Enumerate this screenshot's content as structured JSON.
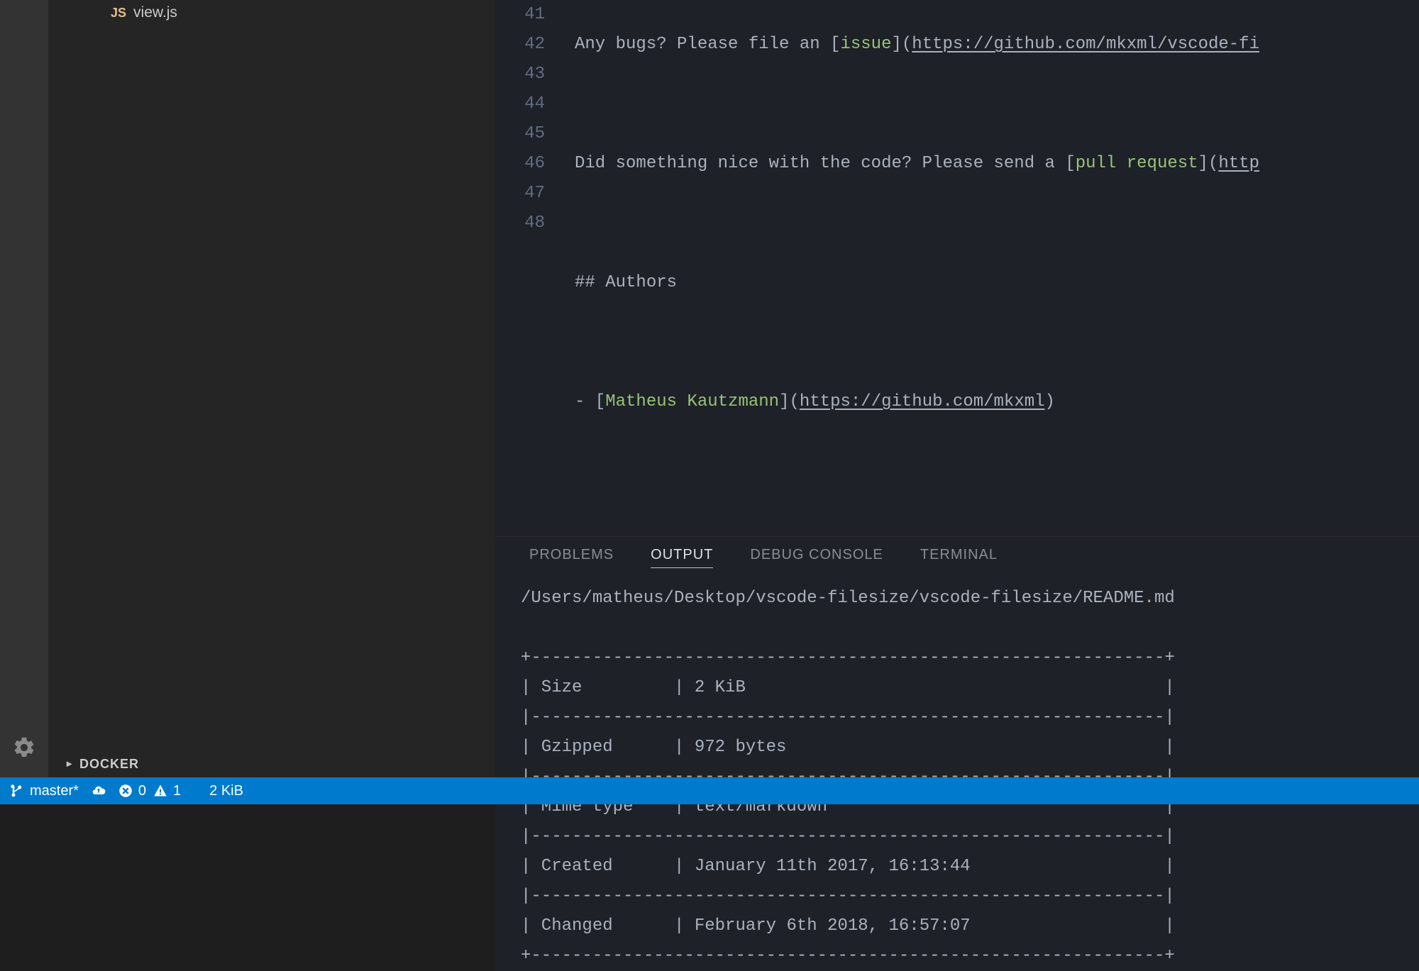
{
  "sidebar": {
    "file": {
      "badge": "JS",
      "name": "view.js"
    },
    "docker_label": "DOCKER"
  },
  "editor": {
    "lines": [
      {
        "n": "41"
      },
      {
        "n": "42"
      },
      {
        "n": "43"
      },
      {
        "n": "44"
      },
      {
        "n": "45"
      },
      {
        "n": "46"
      },
      {
        "n": "47"
      },
      {
        "n": "48"
      }
    ],
    "code": {
      "l41_a": "Any bugs? Please file an [",
      "l41_link": "issue",
      "l41_b": "](",
      "l41_url": "https://github.com/mkxml/vscode-fi",
      "l43_a": "Did something nice with the code? Please send a [",
      "l43_link": "pull request",
      "l43_b": "](",
      "l43_url": "http",
      "l45": "## Authors",
      "l47_a": "- [",
      "l47_link": "Matheus Kautzmann",
      "l47_b": "](",
      "l47_url": "https://github.com/mkxml",
      "l47_c": ")"
    }
  },
  "panel": {
    "tabs": {
      "problems": "PROBLEMS",
      "output": "OUTPUT",
      "debug": "DEBUG CONSOLE",
      "terminal": "TERMINAL"
    }
  },
  "output": {
    "path": "/Users/matheus/Desktop/vscode-filesize/vscode-filesize/README.md",
    "rows": [
      {
        "k": "Size",
        "v": "2 KiB"
      },
      {
        "k": "Gzipped",
        "v": "972 bytes"
      },
      {
        "k": "Mime type",
        "v": "text/markdown"
      },
      {
        "k": "Created",
        "v": "January 11th 2017, 16:13:44"
      },
      {
        "k": "Changed",
        "v": "February 6th 2018, 16:57:07"
      }
    ]
  },
  "statusbar": {
    "branch": "master*",
    "errors": "0",
    "warnings": "1",
    "filesize": "2 KiB"
  }
}
